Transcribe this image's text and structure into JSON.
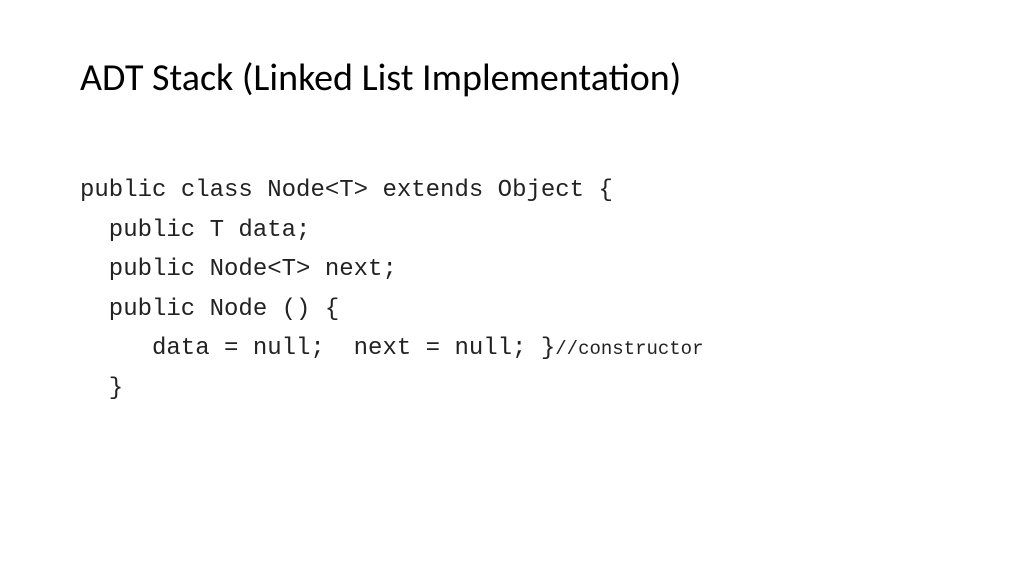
{
  "title": "ADT Stack (Linked List Implementation)",
  "code": {
    "line1": "public class Node<T> extends Object {",
    "line2": "public T data;",
    "line3": "public Node<T> next;",
    "line4": "public Node () {",
    "line5a": "data = null;  next = null; }",
    "line5b": "//constructor",
    "line6": "}"
  }
}
